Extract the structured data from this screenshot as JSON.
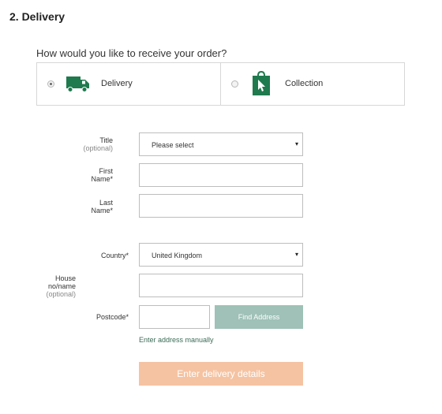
{
  "section": {
    "title": "2. Delivery"
  },
  "receive": {
    "question": "How would you like to receive your order?",
    "options": [
      {
        "label": "Delivery",
        "selected": true,
        "icon": "truck-icon"
      },
      {
        "label": "Collection",
        "selected": false,
        "icon": "shopping-bag-cursor-icon"
      }
    ]
  },
  "form": {
    "title": {
      "label": "Title",
      "note": "(optional)",
      "value": "Please select"
    },
    "first_name": {
      "label_line1": "First",
      "label_line2": "Name*",
      "value": ""
    },
    "last_name": {
      "label_line1": "Last",
      "label_line2": "Name*",
      "value": ""
    },
    "country": {
      "label": "Country*",
      "value": "United Kingdom"
    },
    "house": {
      "label_line1": "House",
      "label_line2": "no/name",
      "note": "(optional)",
      "value": ""
    },
    "postcode": {
      "label": "Postcode*",
      "value": ""
    },
    "find_address": "Find Address",
    "manual_link": "Enter address manually",
    "submit": "Enter delivery details"
  },
  "colors": {
    "brand_green": "#1f7a4d",
    "find_button": "#9fc1b7",
    "submit_button": "#f5c3a2"
  }
}
